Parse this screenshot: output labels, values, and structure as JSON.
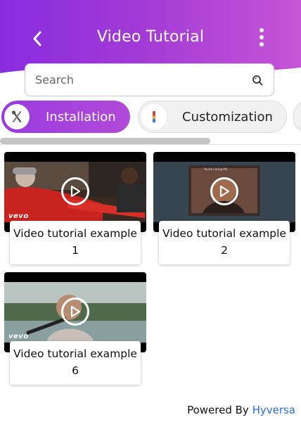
{
  "header": {
    "title": "Video Tutorial",
    "gradient_start": "#8a2be0",
    "gradient_end": "#c654d6"
  },
  "search": {
    "placeholder": "Search",
    "value": ""
  },
  "categories": [
    {
      "label": "Installation",
      "active": true,
      "icon": "tools-icon"
    },
    {
      "label": "Customization",
      "active": false,
      "icon": "paintbrush-icon"
    }
  ],
  "videos": [
    {
      "title": "Video tutorial example",
      "number": "1",
      "watermark": "vevo"
    },
    {
      "title": "Video tutorial example",
      "number": "2",
      "watermark": ""
    },
    {
      "title": "Video tutorial example",
      "number": "6",
      "watermark": "vevo"
    }
  ],
  "footer": {
    "prefix": "Powered By",
    "brand": "Hyversa",
    "brand_color": "#2a6de8"
  }
}
